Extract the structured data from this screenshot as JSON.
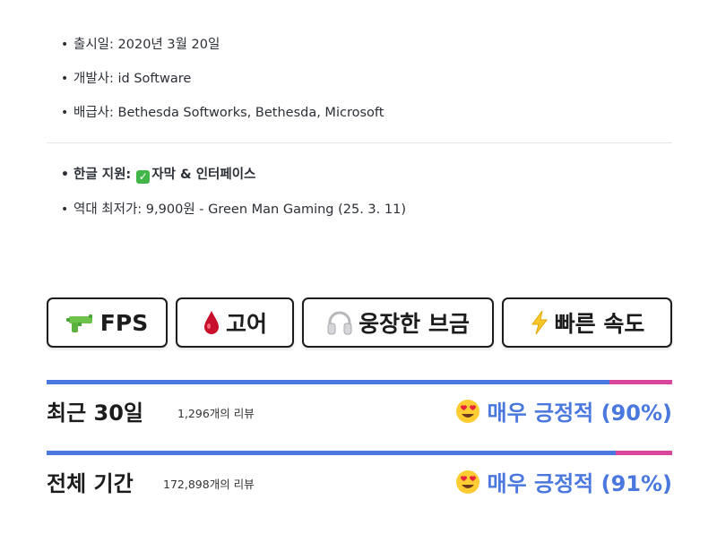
{
  "info_top": [
    {
      "label": "출시일:",
      "value": " 2020년 3월 20일"
    },
    {
      "label": "개발사:",
      "value": " id Software"
    },
    {
      "label": "배급사:",
      "value": " Bethesda Softworks, Bethesda, Microsoft"
    }
  ],
  "korean_support": {
    "label": "한글 지원:",
    "value": "자막 & 인터페이스",
    "icon": "check-mark-icon",
    "icon_color": "#43b649"
  },
  "lowest_price": {
    "label": "역대 최저가:",
    "value": " 9,900원 - Green Man Gaming (25. 3. 11)"
  },
  "bullet": "•",
  "tags": [
    {
      "icon": "water-pistol-icon",
      "label": "FPS"
    },
    {
      "icon": "blood-drop-icon",
      "label": "고어"
    },
    {
      "icon": "headphones-icon",
      "label": "웅장한 브금"
    },
    {
      "icon": "lightning-icon",
      "label": "빠른 속도"
    }
  ],
  "reviews": [
    {
      "title": "최근 30일",
      "count": "1,296개의 리뷰",
      "verdict": "매우 긍정적 (90%)",
      "positive_fraction": 0.9,
      "icon": "heart-eyes-emoji-icon"
    },
    {
      "title": "전체 기간",
      "count": "172,898개의 리뷰",
      "verdict": "매우 긍정적 (91%)",
      "positive_fraction": 0.91,
      "icon": "heart-eyes-emoji-icon"
    }
  ],
  "colors": {
    "positive": "#4a78de",
    "negative": "#d9469b",
    "text": "#2b2f36"
  }
}
